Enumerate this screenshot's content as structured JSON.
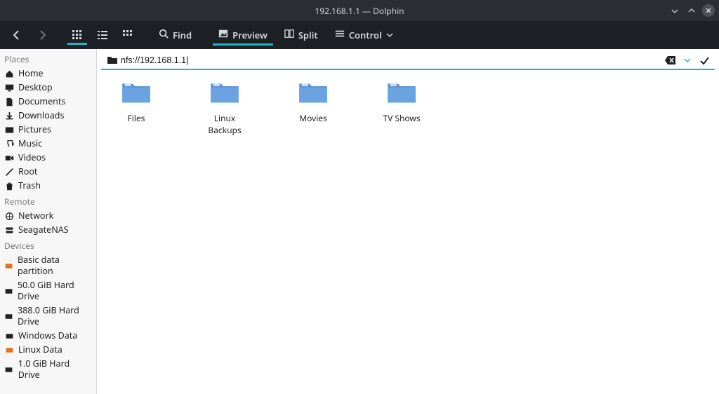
{
  "window_title": "192.168.1.1 — Dolphin",
  "toolbar": {
    "back": "Back",
    "forward": "Forward",
    "icons_view": "Icons",
    "list_view": "Details",
    "compact_view": "Compact",
    "find": "Find",
    "preview": "Preview",
    "split": "Split",
    "control": "Control"
  },
  "address": {
    "path": "nfs://192.168.1.1|"
  },
  "sidebar": {
    "places": {
      "header": "Places",
      "items": [
        "Home",
        "Desktop",
        "Documents",
        "Downloads",
        "Pictures",
        "Music",
        "Videos",
        "Root",
        "Trash"
      ]
    },
    "remote": {
      "header": "Remote",
      "items": [
        "Network",
        "SeagateNAS"
      ]
    },
    "devices": {
      "header": "Devices",
      "items": [
        "Basic data partition",
        "50.0 GiB Hard Drive",
        "388.0 GiB Hard Drive",
        "Windows Data",
        "Linux Data",
        "1.0 GiB Hard Drive"
      ]
    }
  },
  "folders": [
    "Files",
    "Linux Backups",
    "Movies",
    "TV Shows"
  ]
}
